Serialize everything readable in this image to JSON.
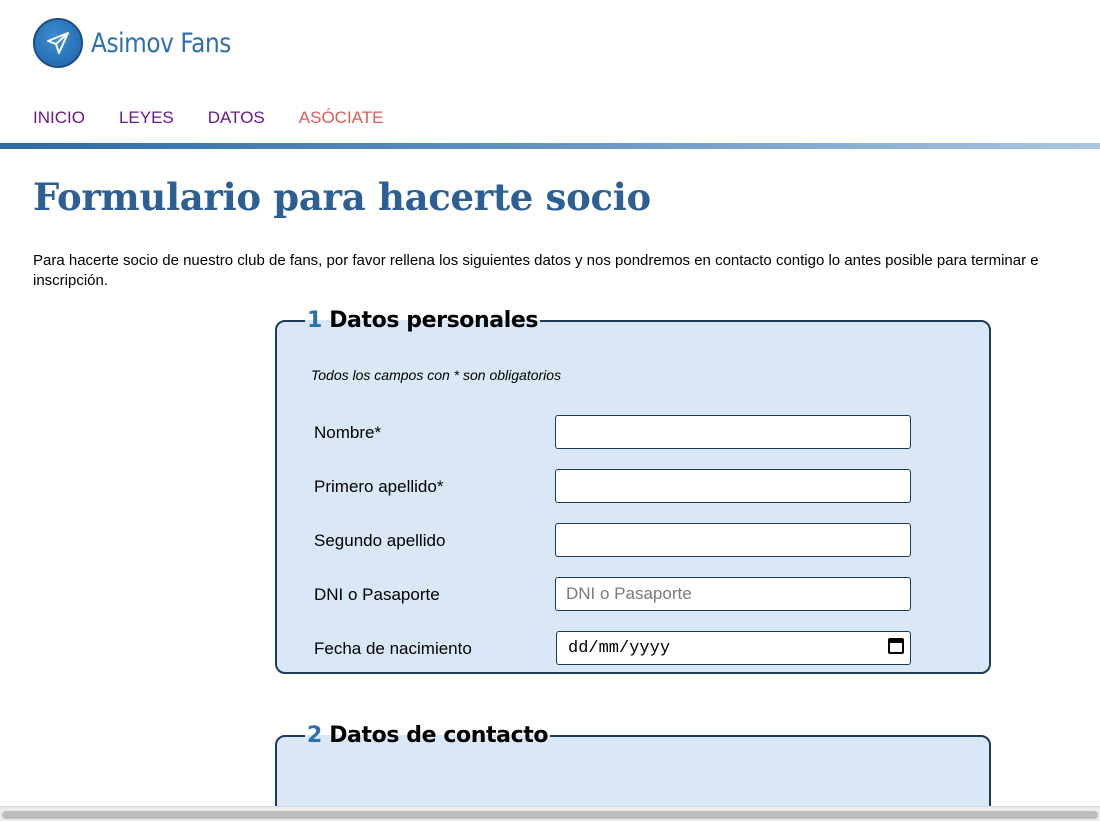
{
  "header": {
    "logo_text": "Asimov Fans"
  },
  "nav": {
    "items": [
      {
        "label": "INICIO"
      },
      {
        "label": "LEYES"
      },
      {
        "label": "DATOS"
      },
      {
        "label": "ASÓCIATE"
      }
    ]
  },
  "main": {
    "title": "Formulario para hacerte socio",
    "intro_line1": "Para hacerte socio de nuestro club de fans, por favor rellena los siguientes datos y nos pondremos en contacto contigo lo antes posible para terminar e",
    "intro_line2": "inscripción."
  },
  "section1": {
    "number": "1",
    "title": "Datos personales",
    "note": "Todos los campos con * son obligatorios",
    "fields": [
      {
        "label": "Nombre*",
        "value": "",
        "placeholder": ""
      },
      {
        "label": "Primero apellido*",
        "value": "",
        "placeholder": ""
      },
      {
        "label": "Segundo apellido",
        "value": "",
        "placeholder": ""
      },
      {
        "label": "DNI o Pasaporte",
        "value": "",
        "placeholder": "DNI o Pasaporte"
      },
      {
        "label": "Fecha de nacimiento",
        "value": "dd/mm/yyyy",
        "placeholder": ""
      }
    ]
  },
  "section2": {
    "number": "2",
    "title": "Datos de contacto"
  },
  "colors": {
    "accent": "#2c5f93",
    "nav_link": "#6a1a8f",
    "nav_active": "#e05a58",
    "fieldset_bg": "#d9e7f6"
  },
  "icons": {
    "logo": "paper-plane-icon",
    "date": "calendar-icon"
  }
}
